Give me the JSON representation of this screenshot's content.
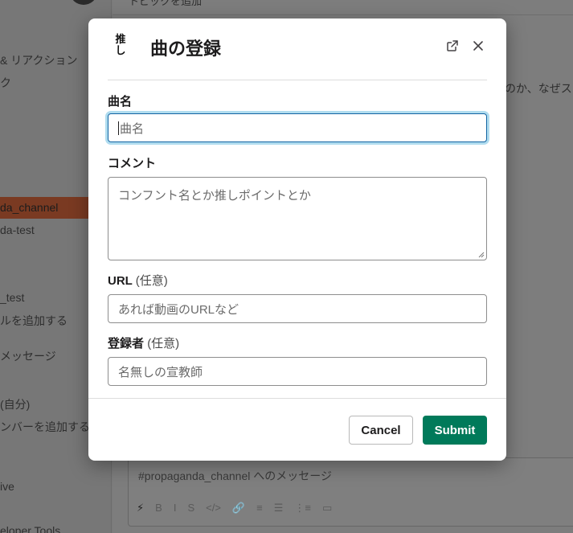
{
  "background": {
    "top_text": "トピックを追加",
    "sidebar_items": [
      "& リアクション",
      "ク",
      "da_channel",
      "da-test",
      "_test",
      "ルを追加する",
      "メッセージ",
      "(自分)",
      "ンバーを追加する",
      "ive",
      "eloper Tools"
    ],
    "message_snippet": "のか、なぜス",
    "composer_placeholder": "#propaganda_channel へのメッセージ",
    "toolbar_icons": [
      "lightning-icon",
      "bold-icon",
      "italic-icon",
      "strikethrough-icon",
      "code-icon",
      "link-icon",
      "ordered-list-icon",
      "bulleted-list-icon",
      "blockquote-icon",
      "code-block-icon"
    ],
    "toolbar_glyphs": [
      "⚡",
      "B",
      "I",
      "S",
      "</>",
      "🔗",
      "≡",
      "☰",
      "⋮≡",
      "▭"
    ]
  },
  "modal": {
    "logo_lines": [
      "推",
      "し"
    ],
    "title": "曲の登録",
    "fields": {
      "song": {
        "label": "曲名",
        "placeholder": "曲名"
      },
      "comment": {
        "label": "コメント",
        "placeholder": "コンフント名とか推しポイントとか"
      },
      "url": {
        "label": "URL",
        "optional": "(任意)",
        "placeholder": "あれば動画のURLなど"
      },
      "registrant": {
        "label": "登録者",
        "optional": "(任意)",
        "placeholder": "名無しの宣教師"
      }
    },
    "buttons": {
      "cancel": "Cancel",
      "submit": "Submit"
    }
  },
  "colors": {
    "submit_bg": "#007a5a",
    "focus_border": "#1264a3",
    "selected_channel_bg": "#7a3a22"
  }
}
